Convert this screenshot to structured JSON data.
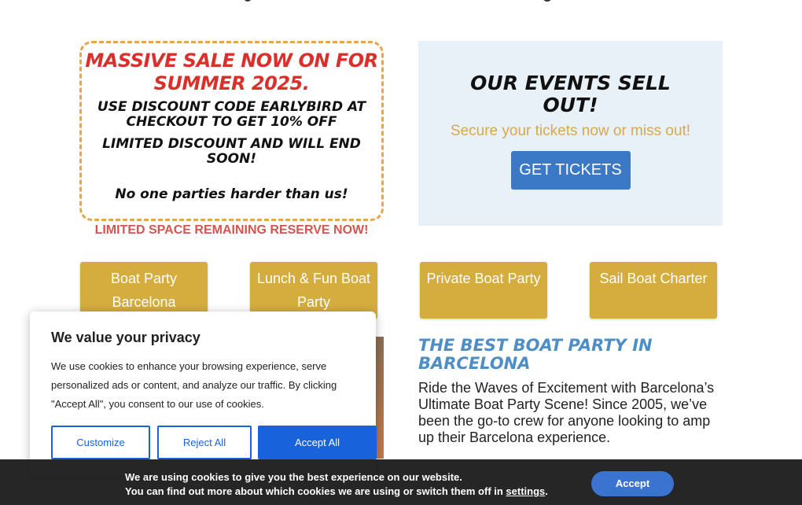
{
  "sale": {
    "title": "MASSIVE SALE NOW ON  FOR SUMMER 2025.",
    "line1": "USE DISCOUNT CODE EARLYBIRD AT CHECKOUT TO GET 10% OFF",
    "line2": "LIMITED DISCOUNT AND WILL END SOON!",
    "line3": "No one parties harder than us!",
    "footer": "LIMITED SPACE REMAINING RESERVE NOW!"
  },
  "events": {
    "title": "OUR EVENTS SELL OUT!",
    "subtitle": "Secure your tickets now or miss out!",
    "button": "GET TICKETS"
  },
  "party_buttons": [
    {
      "label": "Boat Party Barcelona"
    },
    {
      "label": "Lunch & Fun Boat Party"
    },
    {
      "label": "Private Boat Party"
    },
    {
      "label": "Sail Boat Charter"
    }
  ],
  "content": {
    "title": "THE BEST BOAT PARTY IN BARCELONA",
    "text": "Ride the Waves of Excitement with Barcelona’s Ultimate Boat Party Scene! Since 2005, we’ve been the go-to crew for anyone looking to amp up their Barcelona experience."
  },
  "cookie_popup": {
    "title": "We value your privacy",
    "text": "We use cookies to enhance your browsing experience, serve personalized ads or content, and analyze our traffic. By clicking \"Accept All\", you consent to our use of cookies.",
    "customize": "Customize",
    "reject": "Reject All",
    "accept": "Accept All"
  },
  "cookie_bar": {
    "line1": "We are using cookies to give you the best experience on our website.",
    "line2_prefix": "You can find out more about which cookies we are using or switch them off in ",
    "line2_link": "settings",
    "line2_suffix": ".",
    "accept": "Accept"
  },
  "colors": {
    "sale_red": "#d9302c",
    "gold": "#d4ad3e",
    "blue_button": "#3b79c6",
    "cookie_blue": "#1863dc",
    "title_blue": "#4d8ec7"
  }
}
